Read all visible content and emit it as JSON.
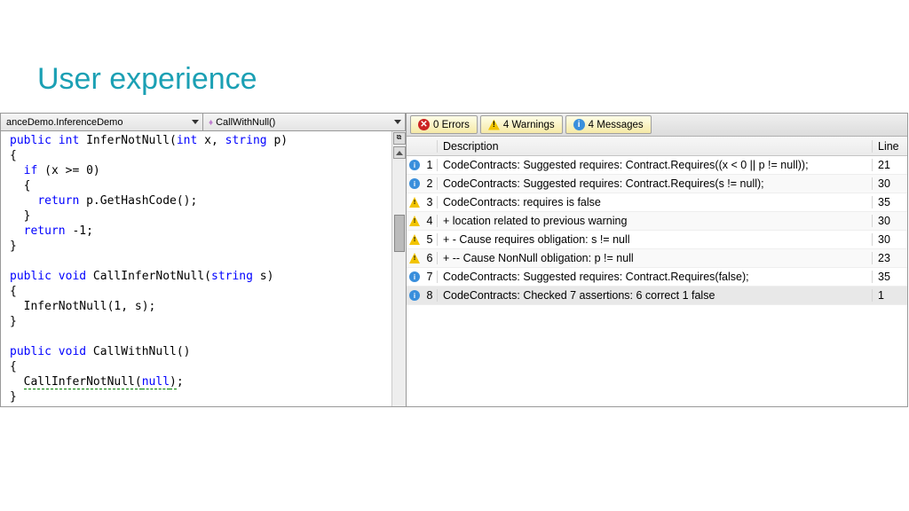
{
  "title": "User experience",
  "code_nav": {
    "left": "anceDemo.InferenceDemo",
    "right": "CallWithNull()"
  },
  "code_tokens": [
    [
      {
        "t": "public",
        "c": "kw"
      },
      {
        "t": " "
      },
      {
        "t": "int",
        "c": "kw"
      },
      {
        "t": " InferNotNull("
      },
      {
        "t": "int",
        "c": "kw"
      },
      {
        "t": " x, "
      },
      {
        "t": "string",
        "c": "kw"
      },
      {
        "t": " p)"
      }
    ],
    [
      {
        "t": "{"
      }
    ],
    [
      {
        "t": "  "
      },
      {
        "t": "if",
        "c": "kw"
      },
      {
        "t": " (x >= 0)"
      }
    ],
    [
      {
        "t": "  {"
      }
    ],
    [
      {
        "t": "    "
      },
      {
        "t": "return",
        "c": "kw"
      },
      {
        "t": " p.GetHashCode();"
      }
    ],
    [
      {
        "t": "  }"
      }
    ],
    [
      {
        "t": "  "
      },
      {
        "t": "return",
        "c": "kw"
      },
      {
        "t": " -1;"
      }
    ],
    [
      {
        "t": "}"
      }
    ],
    [
      {
        "t": ""
      }
    ],
    [
      {
        "t": "public",
        "c": "kw"
      },
      {
        "t": " "
      },
      {
        "t": "void",
        "c": "kw"
      },
      {
        "t": " CallInferNotNull("
      },
      {
        "t": "string",
        "c": "kw"
      },
      {
        "t": " s)"
      }
    ],
    [
      {
        "t": "{"
      }
    ],
    [
      {
        "t": "  InferNotNull(1, s);"
      }
    ],
    [
      {
        "t": "}"
      }
    ],
    [
      {
        "t": ""
      }
    ],
    [
      {
        "t": "public",
        "c": "kw"
      },
      {
        "t": " "
      },
      {
        "t": "void",
        "c": "kw"
      },
      {
        "t": " CallWithNull()"
      }
    ],
    [
      {
        "t": "{"
      }
    ],
    [
      {
        "t": "  "
      },
      {
        "t": "CallInferNotNull(",
        "c": "squiggly"
      },
      {
        "t": "null",
        "c": "kw squiggly"
      },
      {
        "t": ")",
        "c": "squiggly"
      },
      {
        "t": ";"
      }
    ],
    [
      {
        "t": "}"
      }
    ]
  ],
  "tabs": {
    "errors": "0 Errors",
    "warnings": "4 Warnings",
    "messages": "4 Messages"
  },
  "columns": {
    "desc": "Description",
    "line": "Line"
  },
  "rows": [
    {
      "type": "info",
      "num": "1",
      "desc": "CodeContracts: Suggested requires: Contract.Requires((x < 0 || p != null));",
      "line": "21"
    },
    {
      "type": "info",
      "num": "2",
      "desc": "CodeContracts: Suggested requires: Contract.Requires(s != null);",
      "line": "30"
    },
    {
      "type": "warn",
      "num": "3",
      "desc": "CodeContracts: requires is false",
      "line": "35"
    },
    {
      "type": "warn",
      "num": "4",
      "desc": "  + location related to previous warning",
      "line": "30"
    },
    {
      "type": "warn",
      "num": "5",
      "desc": "  + - Cause requires obligation: s != null",
      "line": "30"
    },
    {
      "type": "warn",
      "num": "6",
      "desc": "  + -- Cause NonNull obligation: p != null",
      "line": "23"
    },
    {
      "type": "info",
      "num": "7",
      "desc": "CodeContracts: Suggested requires: Contract.Requires(false);",
      "line": "35"
    },
    {
      "type": "info",
      "num": "8",
      "desc": "CodeContracts: Checked 7 assertions: 6 correct 1 false",
      "line": "1",
      "sel": true
    }
  ]
}
